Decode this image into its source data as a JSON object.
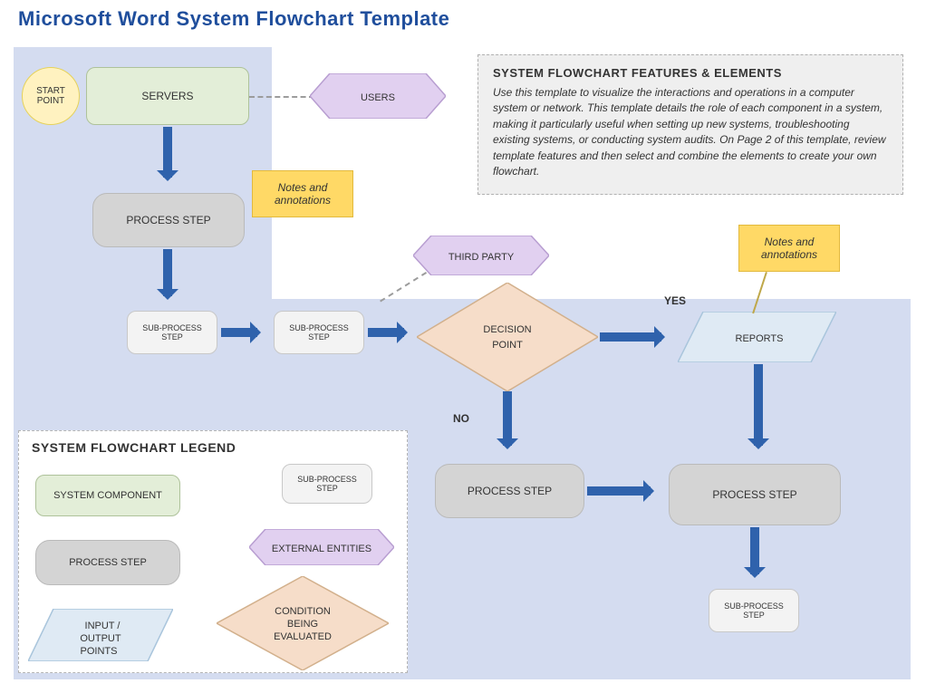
{
  "title": "Microsoft Word System Flowchart Template",
  "start_point": "START POINT",
  "nodes": {
    "servers": "SERVERS",
    "users": "USERS",
    "process_step_1": "PROCESS STEP",
    "note_1": "Notes and annotations",
    "sub_process_1": "SUB-PROCESS STEP",
    "sub_process_2": "SUB-PROCESS STEP",
    "third_party": "THIRD PARTY",
    "decision": "DECISION POINT",
    "reports": "REPORTS",
    "note_2": "Notes and annotations",
    "yes": "YES",
    "no": "NO",
    "process_step_left": "PROCESS STEP",
    "process_step_right": "PROCESS STEP",
    "sub_process_3": "SUB-PROCESS STEP"
  },
  "features": {
    "title": "SYSTEM FLOWCHART FEATURES & ELEMENTS",
    "body": "Use this template to visualize the interactions and operations in a computer system or network. This template details the role of each component in a system, making it particularly useful when setting up new systems, troubleshooting existing systems, or conducting system audits. On Page 2 of this template, review template features and then select and combine the elements to create your own flowchart."
  },
  "legend": {
    "title": "SYSTEM FLOWCHART LEGEND",
    "system_component": "SYSTEM COMPONENT",
    "process_step": "PROCESS STEP",
    "sub_process": "SUB-PROCESS STEP",
    "external_entities": "EXTERNAL ENTITIES",
    "condition": "CONDITION BEING EVALUATED",
    "io_points": "INPUT / OUTPUT POINTS"
  }
}
